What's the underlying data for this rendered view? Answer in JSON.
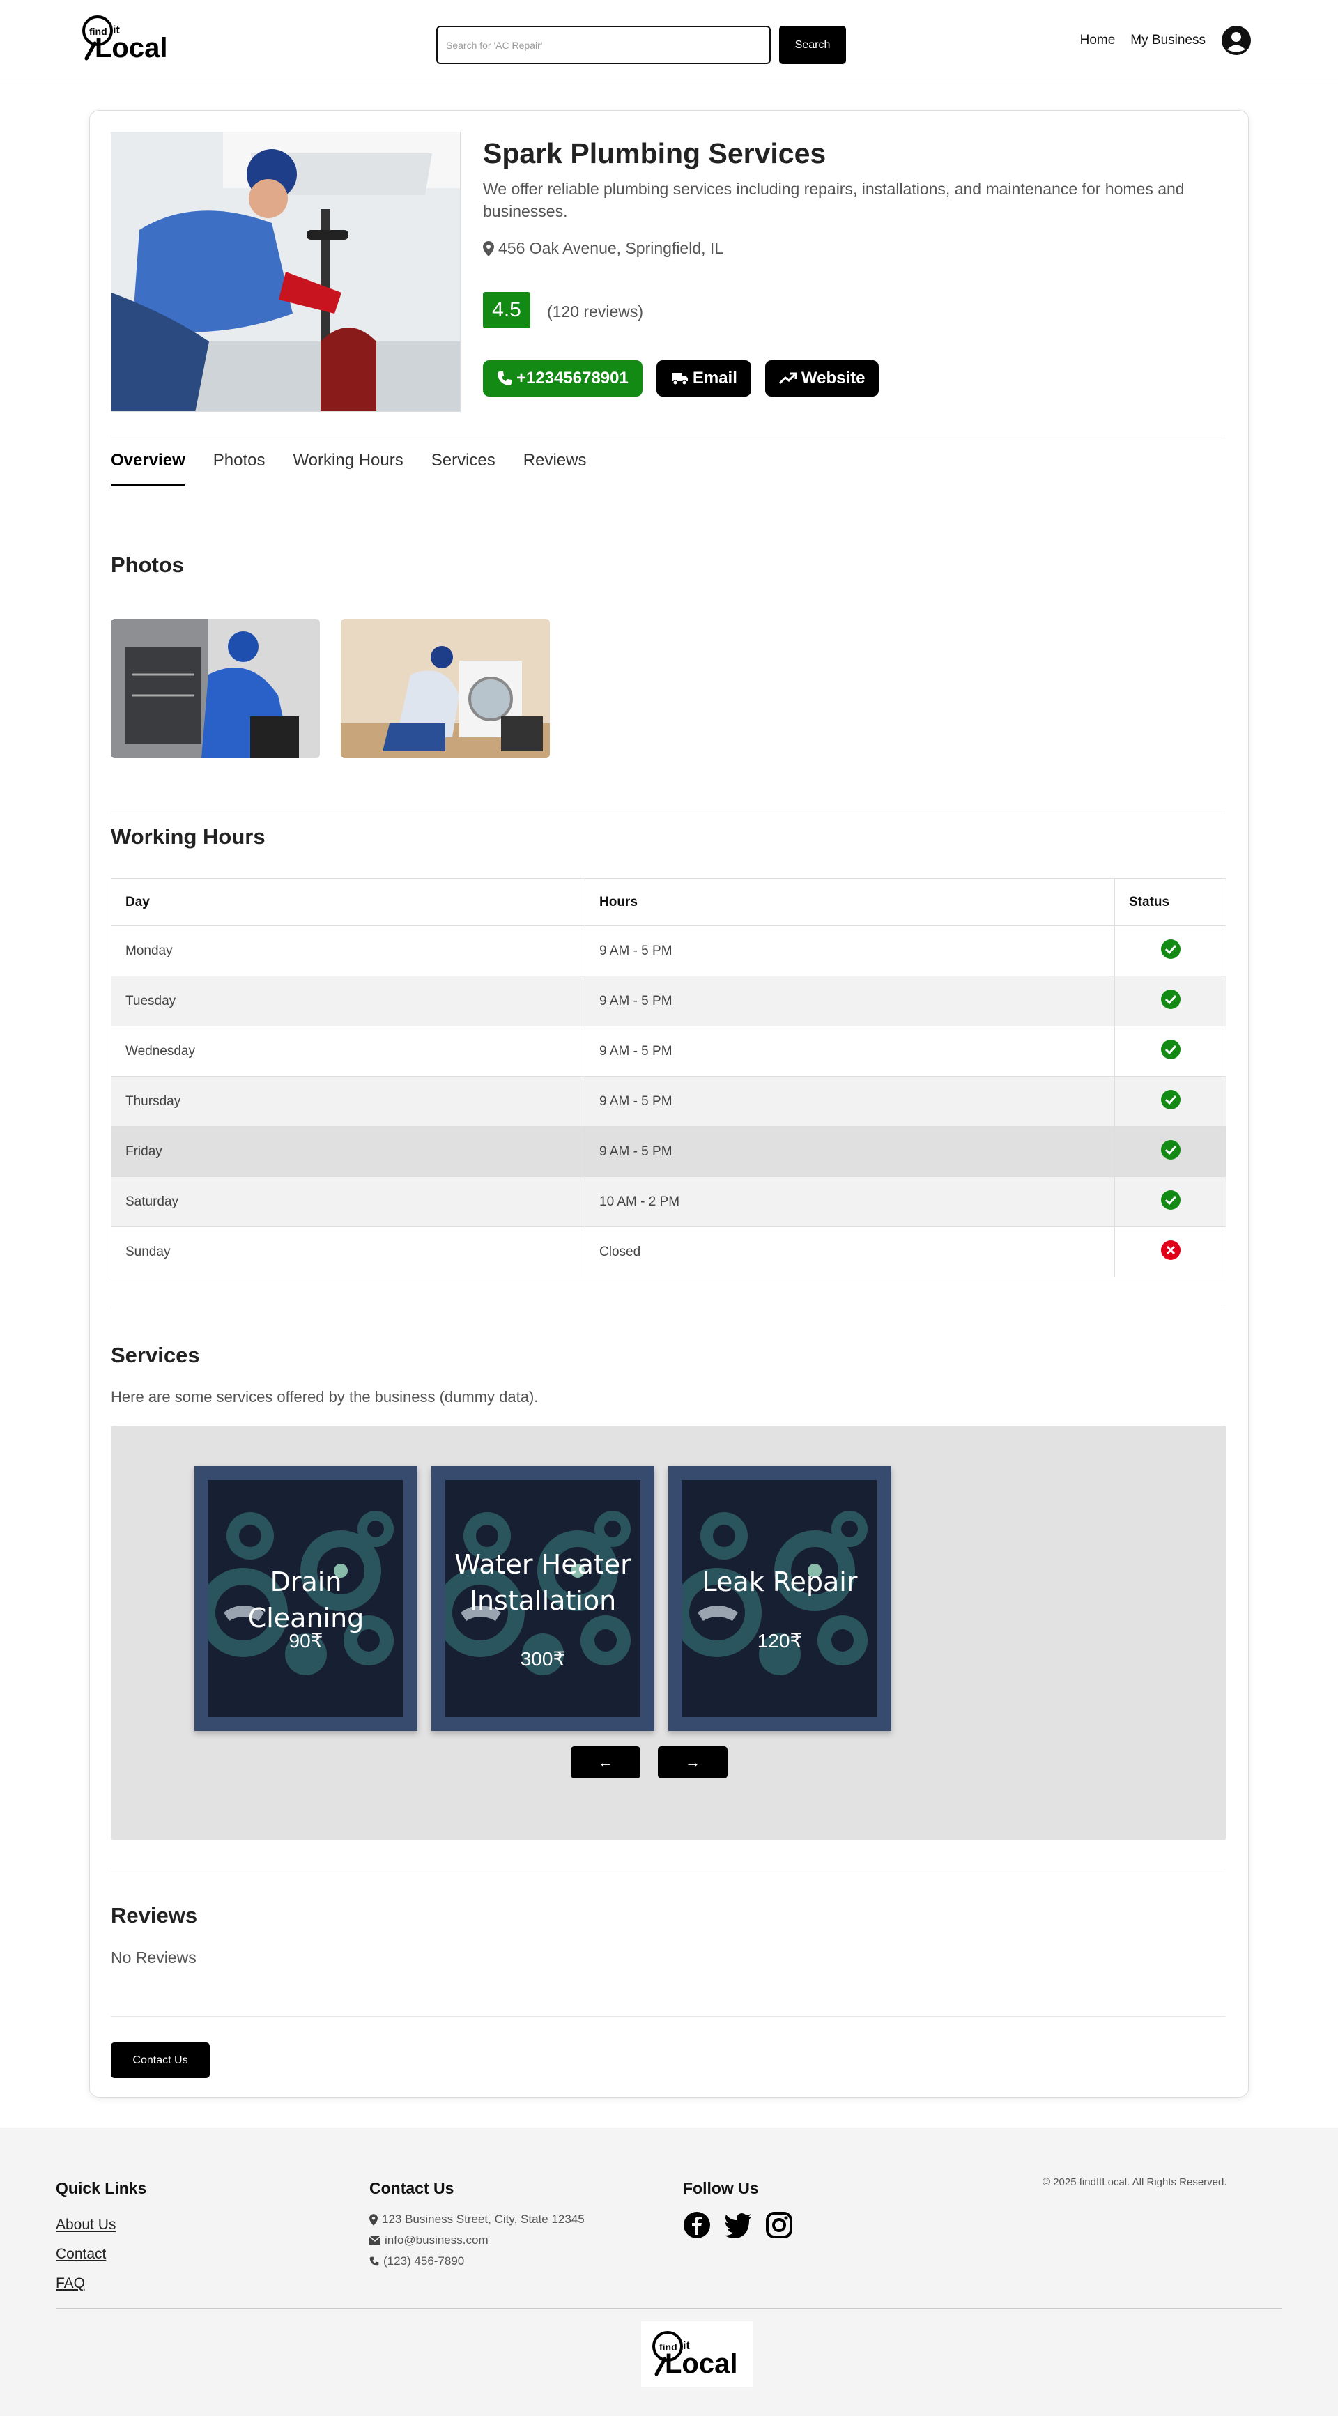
{
  "header": {
    "logo_small": "find",
    "logo_it": "it",
    "logo_big": "Local",
    "search_placeholder": "Search for 'AC Repair'",
    "search_button": "Search",
    "nav_home": "Home",
    "nav_business": "My Business"
  },
  "business": {
    "name": "Spark Plumbing Services",
    "description": "We offer reliable plumbing services including repairs, installations, and maintenance for homes and businesses.",
    "address": "456 Oak Avenue, Springfield, IL",
    "rating": "4.5",
    "reviews_count": "(120 reviews)",
    "phone": "+12345678901",
    "email_label": "Email",
    "website_label": "Website"
  },
  "tabs": [
    "Overview",
    "Photos",
    "Working Hours",
    "Services",
    "Reviews"
  ],
  "photos": {
    "title": "Photos"
  },
  "hours": {
    "title": "Working Hours",
    "headers": [
      "Day",
      "Hours",
      "Status"
    ],
    "rows": [
      {
        "day": "Monday",
        "hours": "9 AM - 5 PM",
        "open": true
      },
      {
        "day": "Tuesday",
        "hours": "9 AM - 5 PM",
        "open": true
      },
      {
        "day": "Wednesday",
        "hours": "9 AM - 5 PM",
        "open": true
      },
      {
        "day": "Thursday",
        "hours": "9 AM - 5 PM",
        "open": true
      },
      {
        "day": "Friday",
        "hours": "9 AM - 5 PM",
        "open": true
      },
      {
        "day": "Saturday",
        "hours": "10 AM - 2 PM",
        "open": true
      },
      {
        "day": "Sunday",
        "hours": "Closed",
        "open": false
      }
    ]
  },
  "services": {
    "title": "Services",
    "subtitle": "Here are some services offered by the business (dummy data).",
    "items": [
      {
        "name": "Drain Cleaning",
        "price": "90₹"
      },
      {
        "name": "Water Heater Installation",
        "price": "300₹"
      },
      {
        "name": "Leak Repair",
        "price": "120₹"
      }
    ],
    "prev": "←",
    "next": "→"
  },
  "reviews": {
    "title": "Reviews",
    "empty": "No Reviews"
  },
  "contact_button": "Contact Us",
  "footer": {
    "quick_links_title": "Quick Links",
    "links": [
      "About Us",
      "Contact",
      "FAQ"
    ],
    "contact_title": "Contact Us",
    "address": "123 Business Street, City, State 12345",
    "email": "info@business.com",
    "phone": "(123) 456-7890",
    "follow_title": "Follow Us",
    "copyright": "© 2025 findItLocal. All Rights Reserved."
  },
  "colors": {
    "accent_green": "#138a13",
    "closed_red": "#e0001a",
    "dark": "#000000"
  }
}
